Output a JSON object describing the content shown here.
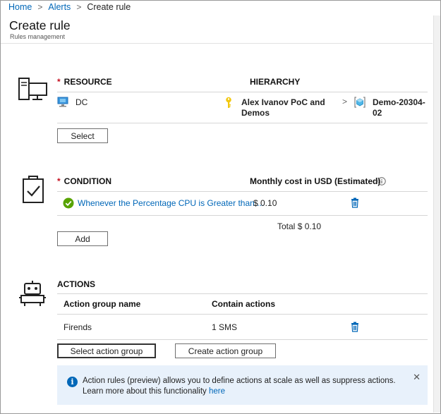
{
  "breadcrumb": {
    "home": "Home",
    "alerts": "Alerts",
    "current": "Create rule",
    "separator": ">"
  },
  "page": {
    "title": "Create rule",
    "subtitle": "Rules management"
  },
  "resource": {
    "required_mark": "*",
    "header": "RESOURCE",
    "hierarchy_header": "HIERARCHY",
    "name": "DC",
    "hierarchy_line1": "Alex Ivanov PoC and",
    "hierarchy_line2": "Demos",
    "chevron": ">",
    "target_line1": "Demo-20304-",
    "target_line2": "02",
    "select_button": "Select"
  },
  "condition": {
    "required_mark": "*",
    "header": "CONDITION",
    "cost_header": "Monthly cost in USD (Estimated)",
    "item_text": "Whenever the Percentage CPU is Greater than ...",
    "item_cost": "$ 0.10",
    "total_label": "Total",
    "total_value": "$ 0.10",
    "add_button": "Add"
  },
  "actions": {
    "header": "ACTIONS",
    "col_name": "Action group name",
    "col_contain": "Contain actions",
    "row_name": "Firends",
    "row_contain": "1 SMS",
    "select_button": "Select action group",
    "create_button": "Create action group"
  },
  "info": {
    "text": "Action rules (preview) allows you to define actions at scale as well as suppress actions. Learn more about this functionality ",
    "link": "here",
    "close": "✕"
  },
  "colors": {
    "link": "#0067b8",
    "required": "#c50f1f",
    "success": "#57a300",
    "info_bg": "#e8f1fb"
  }
}
